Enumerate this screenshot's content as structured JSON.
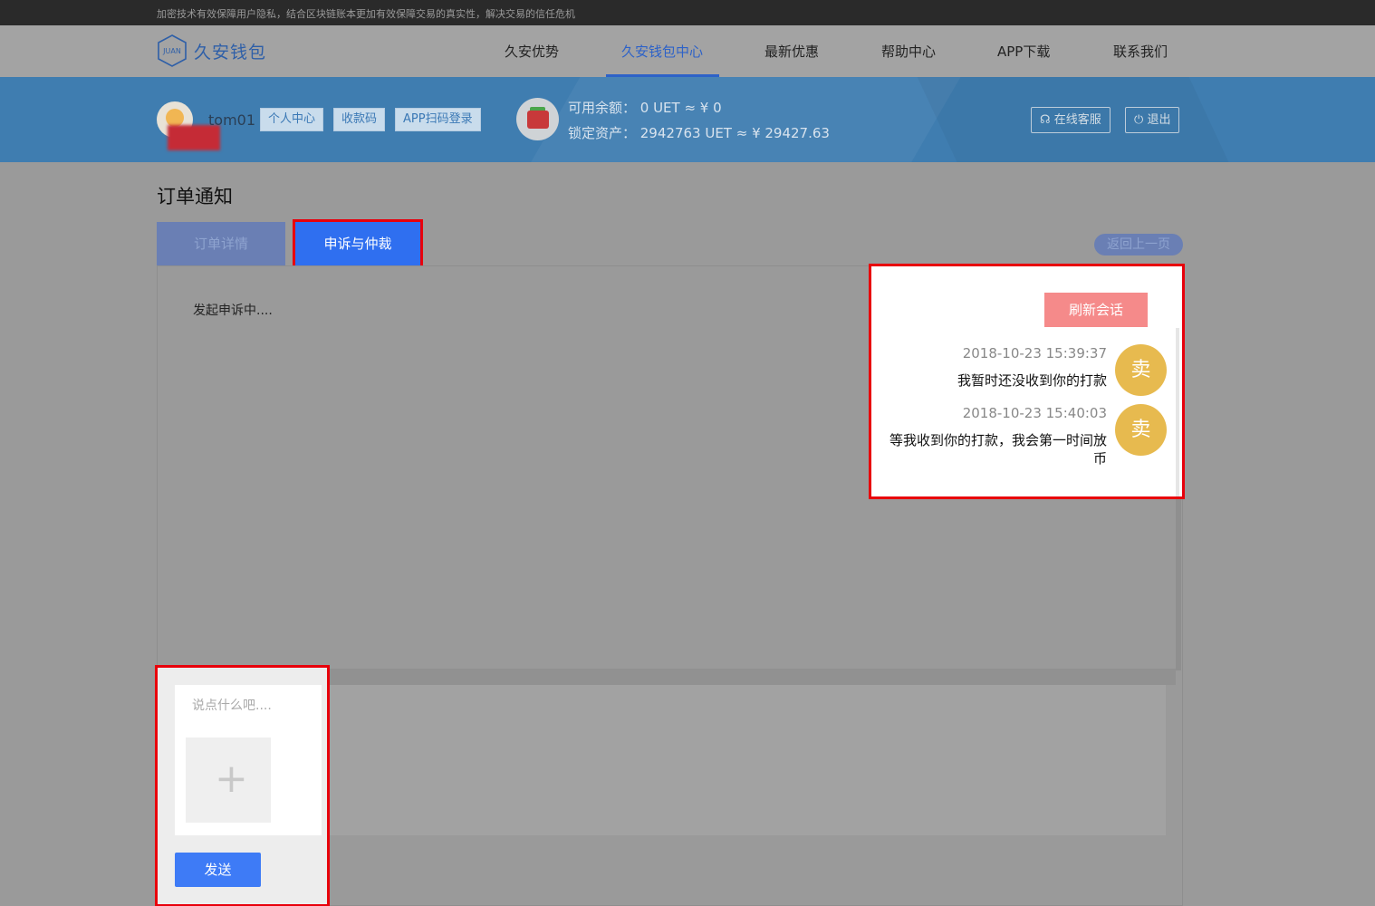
{
  "topbar": {
    "text": "加密技术有效保障用户隐私，结合区块链账本更加有效保障交易的真实性，解决交易的信任危机"
  },
  "brand": {
    "logo_text": "久安钱包",
    "logo_mark_text": "JUAN"
  },
  "nav": {
    "items": [
      {
        "label": "久安优势"
      },
      {
        "label": "久安钱包中心"
      },
      {
        "label": "最新优惠"
      },
      {
        "label": "帮助中心"
      },
      {
        "label": "APP下载"
      },
      {
        "label": "联系我们"
      }
    ],
    "active_index": 1
  },
  "user": {
    "username": "tom01",
    "buttons": [
      "个人中心",
      "收款码",
      "APP扫码登录"
    ]
  },
  "balance": {
    "available": "可用余额： 0 UET ≈ ¥ 0",
    "locked": "锁定资产： 2942763 UET ≈ ¥ 29427.63"
  },
  "banner_actions": {
    "service": "在线客服",
    "logout": "退出"
  },
  "page": {
    "title": "订单通知"
  },
  "tabs": [
    {
      "label": "订单详情"
    },
    {
      "label": "申诉与仲裁"
    }
  ],
  "active_tab": 1,
  "back_label": "返回上一页",
  "status_text": "发起申诉中....",
  "chat": {
    "refresh_label": "刷新会话",
    "messages": [
      {
        "time": "2018-10-23 15:39:37",
        "text": "我暂时还没收到你的打款",
        "sender_badge": "卖"
      },
      {
        "time": "2018-10-23 15:40:03",
        "text": "等我收到你的打款，我会第一时间放币",
        "sender_badge": "卖"
      }
    ]
  },
  "compose": {
    "placeholder": "说点什么吧....",
    "send_label": "发送",
    "upload_icon": "+"
  },
  "colors": {
    "accent": "#2f6ff0",
    "highlight_outline": "#e8000b",
    "refresh": "#f58a8a",
    "badge": "#e7ba4f",
    "banner": "#3f7db0"
  }
}
